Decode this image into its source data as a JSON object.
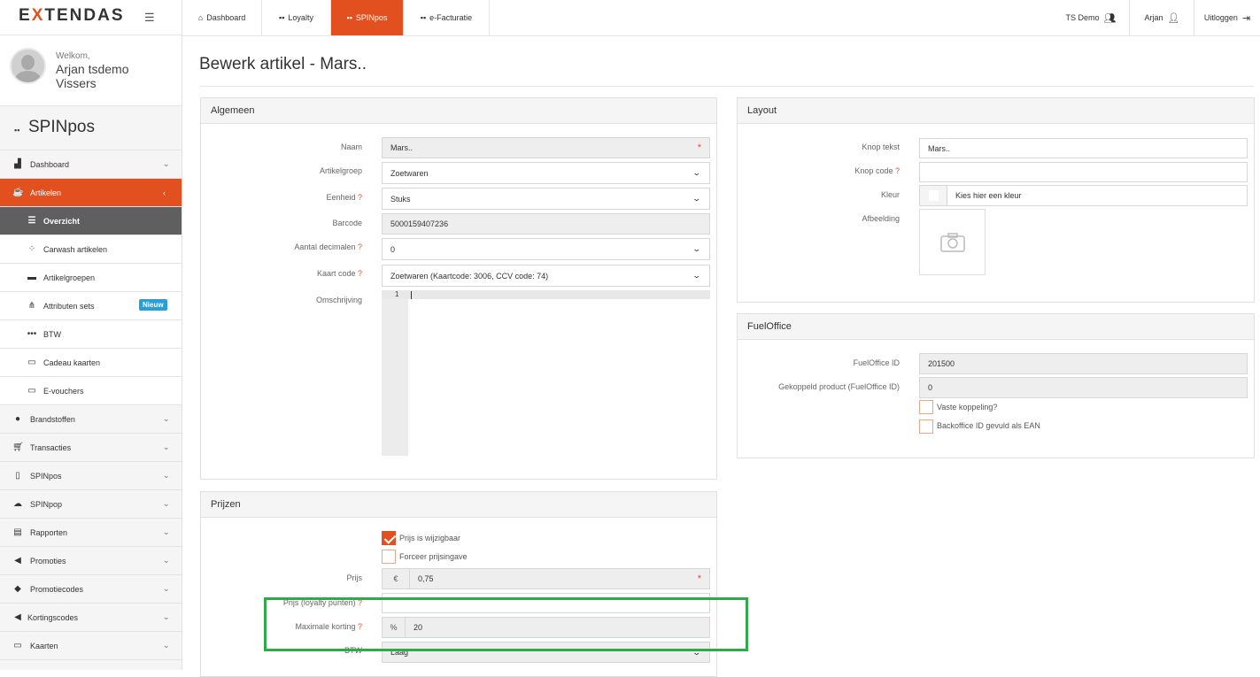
{
  "brand": {
    "logo_pre": "E",
    "logo_x": "X",
    "logo_post": "TENDAS",
    "accent": "#e3501f"
  },
  "user": {
    "welcome": "Welkom,",
    "name": "Arjan tsdemo Vissers"
  },
  "sidebar": {
    "section_title": "SPINpos",
    "items": [
      {
        "label": "Dashboard",
        "icon": "bar-chart-icon"
      },
      {
        "label": "Artikelen",
        "icon": "coffee-icon"
      },
      {
        "label": "Overzicht",
        "icon": "list-icon"
      },
      {
        "label": "Carwash artikelen",
        "icon": "drops-icon"
      },
      {
        "label": "Artikelgroepen",
        "icon": "archive-icon"
      },
      {
        "label": "Attributen sets",
        "icon": "sitemap-icon",
        "badge": "Nieuw"
      },
      {
        "label": "BTW",
        "icon": "dots-icon"
      },
      {
        "label": "Cadeau kaarten",
        "icon": "card-icon"
      },
      {
        "label": "E-vouchers",
        "icon": "card-icon"
      },
      {
        "label": "Brandstoffen",
        "icon": "drop-icon"
      },
      {
        "label": "Transacties",
        "icon": "cart-icon"
      },
      {
        "label": "SPINpos",
        "icon": "mobile-icon"
      },
      {
        "label": "SPINpop",
        "icon": "cloud-icon"
      },
      {
        "label": "Rapporten",
        "icon": "inbox-icon"
      },
      {
        "label": "Promoties",
        "icon": "megaphone-icon"
      },
      {
        "label": "Promotiecodes",
        "icon": "tag-icon"
      },
      {
        "label": "Kortingscodes",
        "icon": "megaphone-icon"
      },
      {
        "label": "Kaarten",
        "icon": "card-icon"
      }
    ]
  },
  "topnav": {
    "tabs": [
      {
        "label": "Dashboard",
        "icon": "home-icon"
      },
      {
        "label": "Loyalty",
        "icon": "grid-icon"
      },
      {
        "label": "SPINpos",
        "icon": "grid-icon"
      },
      {
        "label": "e-Facturatie",
        "icon": "grid-icon"
      }
    ],
    "right": [
      {
        "label": "TS Demo",
        "icon": "users-icon"
      },
      {
        "label": "Arjan",
        "icon": "user-icon"
      },
      {
        "label": "Uitloggen",
        "icon": "logout-icon"
      }
    ]
  },
  "page": {
    "title": "Bewerk artikel - Mars.."
  },
  "algemeen": {
    "title": "Algemeen",
    "naam_label": "Naam",
    "naam_value": "Mars..",
    "artikelgroep_label": "Artikelgroep",
    "artikelgroep_value": "Zoetwaren",
    "eenheid_label": "Eenheid",
    "eenheid_value": "Stuks",
    "barcode_label": "Barcode",
    "barcode_value": "5000159407236",
    "decimalen_label": "Aantal decimalen",
    "decimalen_value": "0",
    "kaartcode_label": "Kaart code",
    "kaartcode_value": "Zoetwaren (Kaartcode: 3006, CCV code: 74)",
    "omschrijving_label": "Omschrijving",
    "line_number": "1"
  },
  "prijzen": {
    "title": "Prijzen",
    "wijzigbaar_label": "Prijs is wijzigbaar",
    "forceer_label": "Forceer prijsingave",
    "prijs_label": "Prijs",
    "prijs_currency": "€",
    "prijs_value": "0,75",
    "loyalty_label": "Prijs (loyalty punten)",
    "korting_label": "Maximale korting",
    "korting_unit": "%",
    "korting_value": "20",
    "btw_label": "BTW",
    "btw_value": "Laag"
  },
  "layout": {
    "title": "Layout",
    "knoptekst_label": "Knop tekst",
    "knoptekst_value": "Mars..",
    "knopcode_label": "Knop code",
    "kleur_label": "Kleur",
    "kleur_placeholder": "Kies hier een kleur",
    "afbeelding_label": "Afbeelding"
  },
  "fueloffice": {
    "title": "FuelOffice",
    "id_label": "FuelOffice ID",
    "id_value": "201500",
    "gekoppeld_label": "Gekoppeld product (FuelOffice ID)",
    "gekoppeld_value": "0",
    "vaste_label": "Vaste koppeling?",
    "backoffice_label": "Backoffice ID gevuld als EAN"
  },
  "q": "?",
  "req": "*"
}
